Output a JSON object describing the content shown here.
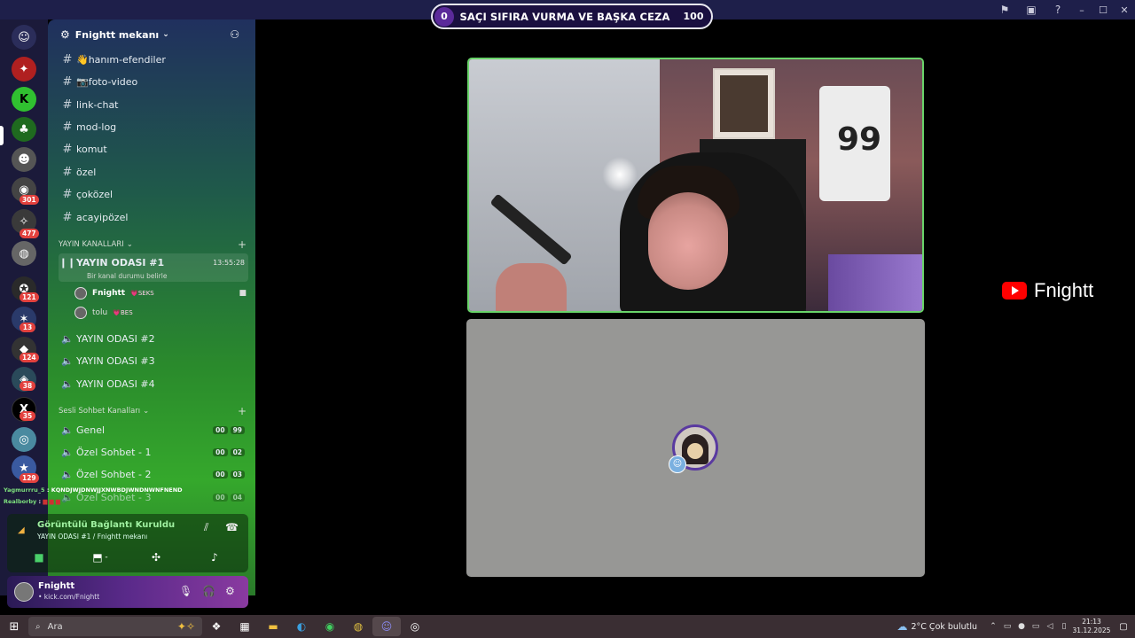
{
  "window": {
    "title": "Fnightt mekanı"
  },
  "banner": {
    "left": "0",
    "text": "SAÇI SIFIRA VURMA VE BAŞKA CEZA",
    "right": "100"
  },
  "rail": {
    "badges": [
      "301",
      "477",
      "121",
      "13",
      "124",
      "38",
      "35",
      "129"
    ]
  },
  "server": {
    "name": "Fnightt mekanı"
  },
  "text_channels": [
    {
      "label": "👋hanım-efendiler"
    },
    {
      "label": "📷foto-video"
    },
    {
      "label": "link-chat"
    },
    {
      "label": "mod-log"
    },
    {
      "label": "komut"
    },
    {
      "label": "özel"
    },
    {
      "label": "çoközel"
    },
    {
      "label": "acayipözel"
    }
  ],
  "categories": {
    "stream": "YAYIN KANALLARI",
    "voice": "Sesli Sohbet Kanalları"
  },
  "stream_channels": {
    "active": {
      "label": "YAYIN ODASI #1",
      "time": "13:55:28",
      "status": "Bir kanal durumu belirle"
    },
    "users": [
      {
        "name": "Fnightt",
        "tag": "💗SEKS"
      },
      {
        "name": "tolu",
        "tag": "💗BES"
      }
    ],
    "others": [
      {
        "label": "YAYIN ODASI #2"
      },
      {
        "label": "YAYIN ODASI #3"
      },
      {
        "label": "YAYIN ODASI #4"
      }
    ]
  },
  "voice_channels": [
    {
      "label": "Genel",
      "a": "00",
      "b": "99"
    },
    {
      "label": "Özel Sohbet - 1",
      "a": "00",
      "b": "02"
    },
    {
      "label": "Özel Sohbet - 2",
      "a": "00",
      "b": "03"
    },
    {
      "label": "Özel Sohbet - 3",
      "a": "00",
      "b": "04"
    }
  ],
  "chat_overlay": [
    {
      "name": "Yagmurrru_5",
      "msg": ": KQNDJWJDNWJJXNWBDJWNDNWNFNEND"
    },
    {
      "name": "Realborby",
      "msg": ":"
    }
  ],
  "voice_panel": {
    "title": "Görüntülü Bağlantı Kuruldu",
    "subtitle": "YAYIN ODASI #1 / Fnightt mekanı",
    "separator": "-"
  },
  "user_panel": {
    "name": "Fnightt",
    "subtitle": "• kick.com/Fnightt"
  },
  "stage": {
    "brand_name": "Fnightt",
    "jersey_text": "99"
  },
  "taskbar": {
    "search_placeholder": "Ara",
    "weather": "2°C  Çok bulutlu",
    "time": "21:13",
    "date": "31.12.2025"
  },
  "colors": {
    "accent_green": "#6ad46a",
    "badge_red": "#e3413e",
    "youtube_red": "#ff0000"
  }
}
